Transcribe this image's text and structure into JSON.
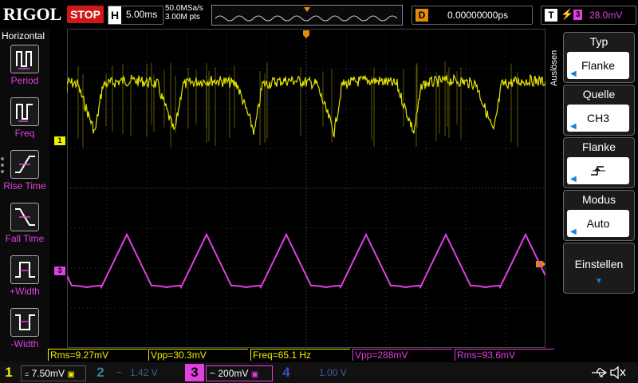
{
  "brand": "RIGOL",
  "run_state": "STOP",
  "timebase": {
    "label": "H",
    "value": "5.00ms"
  },
  "sampling": {
    "rate": "50.0MSa/s",
    "points": "3.00M pts"
  },
  "delay": {
    "label": "D",
    "value": "0.00000000ps"
  },
  "trigger": {
    "label": "T",
    "source_badge": "3",
    "level": "28.0mV"
  },
  "left_menu": {
    "title": "Horizontal",
    "items": [
      {
        "label": "Period",
        "icon": "period-icon"
      },
      {
        "label": "Freq",
        "icon": "freq-icon"
      },
      {
        "label": "Rise Time",
        "icon": "rise-time-icon"
      },
      {
        "label": "Fall Time",
        "icon": "fall-time-icon"
      },
      {
        "label": "+Width",
        "icon": "pos-width-icon"
      },
      {
        "label": "-Width",
        "icon": "neg-width-icon"
      }
    ]
  },
  "right_menu": {
    "side_label": "Auslösen",
    "items": [
      {
        "header": "Typ",
        "value": "Flanke"
      },
      {
        "header": "Quelle",
        "value": "CH3"
      },
      {
        "header": "Flanke",
        "value": ""
      },
      {
        "header": "Modus",
        "value": "Auto"
      }
    ],
    "settings_label": "Einstellen"
  },
  "channel_markers": {
    "ch1": "1",
    "ch3": "3"
  },
  "measurements": [
    {
      "text": "Rms=9.27mV",
      "color": "#f0f000"
    },
    {
      "text": "Vpp=30.3mV",
      "color": "#f0f000"
    },
    {
      "text": "Freq=65.1 Hz",
      "color": "#f0f000"
    },
    {
      "text": "Vpp=288mV",
      "color": "#e040e0"
    },
    {
      "text": "Rms=93.6mV",
      "color": "#e040e0"
    }
  ],
  "channels": [
    {
      "num": "1",
      "coupling": "=",
      "scale": "7.50mV",
      "active": true,
      "color": "#f0f000"
    },
    {
      "num": "2",
      "coupling": "~",
      "scale": "1.42 V",
      "active": false,
      "color": "#3a7f9a"
    },
    {
      "num": "3",
      "coupling": "~",
      "scale": "200mV",
      "active": true,
      "color": "#e040e0"
    },
    {
      "num": "4",
      "coupling": "",
      "scale": "1.00 V",
      "active": false,
      "color": "#3a4fbf"
    }
  ],
  "colors": {
    "ch1": "#f0f000",
    "ch3": "#e040e0",
    "trigger": "#e58b0c",
    "stop": "#d01818"
  }
}
